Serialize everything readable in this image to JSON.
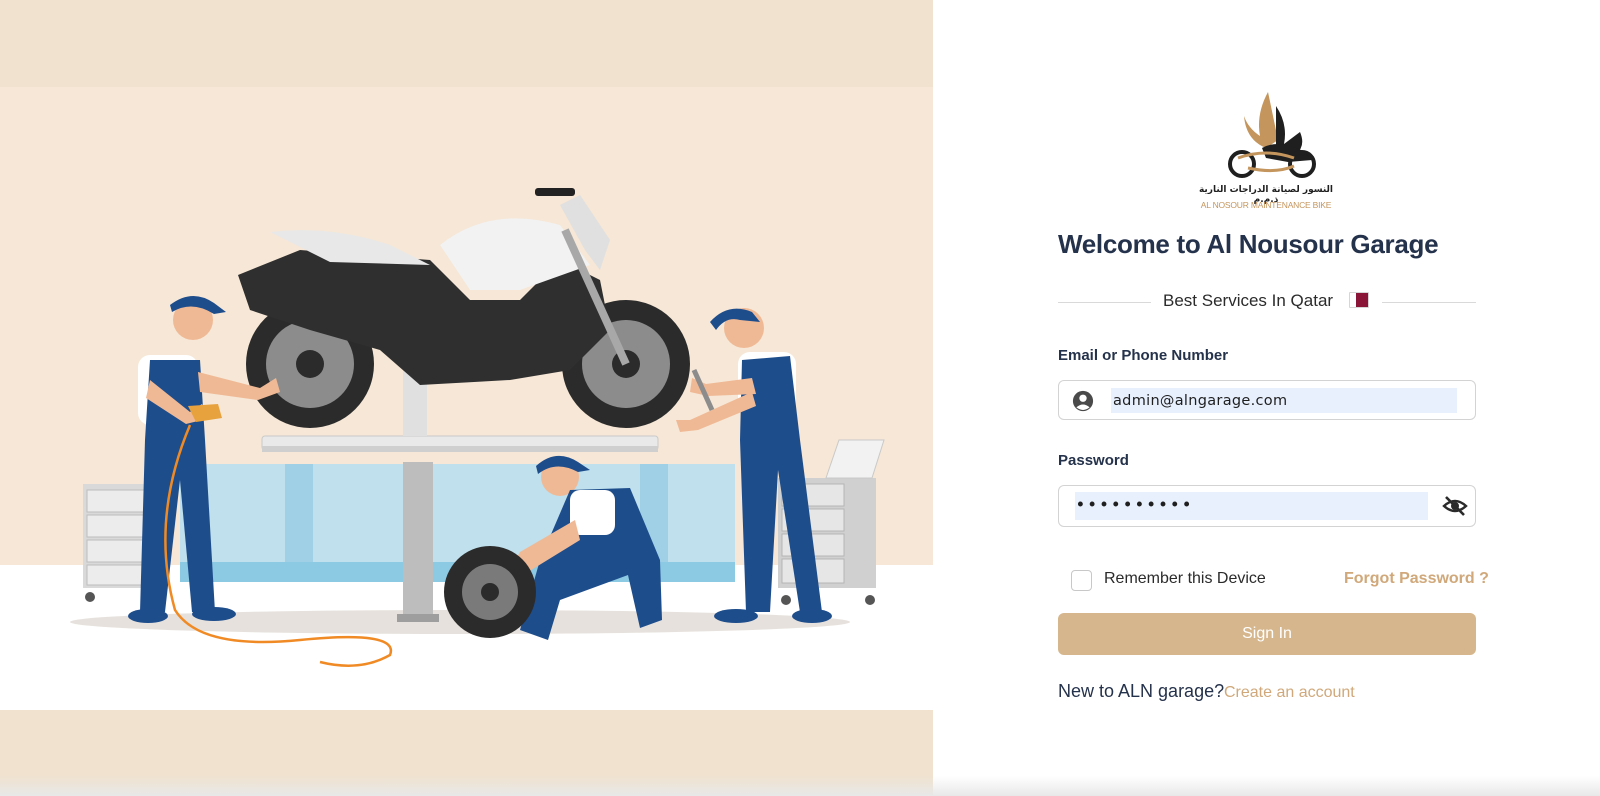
{
  "logo": {
    "arabic_name": "النسور لصيانة الدراجات النارية ذ.م.م",
    "english_name": "AL NOSOUR MAINTENANCE BIKE",
    "icon": "winged-motorcycle-logo"
  },
  "illustration": {
    "icon": "mechanics-repairing-motorcycle-illustration"
  },
  "header": {
    "welcome": "Welcome to Al Nousour Garage",
    "tagline": "Best Services In Qatar",
    "flag_icon": "qatar-flag-icon"
  },
  "form": {
    "email_label": "Email or Phone Number",
    "email_value": "admin@alngarage.com",
    "password_label": "Password",
    "password_value": "••••••••••",
    "remember_label": "Remember this Device",
    "forgot_label": "Forgot Password ?",
    "signin_label": "Sign In"
  },
  "footer": {
    "new_to": "New to ALN garage?",
    "create_account": "Create an account"
  },
  "colors": {
    "accent": "#d6b68c",
    "link": "#d0a87a",
    "heading": "#25324b",
    "left_bg": "#f1e2cf",
    "overall_blue": "#1e4d8c"
  }
}
